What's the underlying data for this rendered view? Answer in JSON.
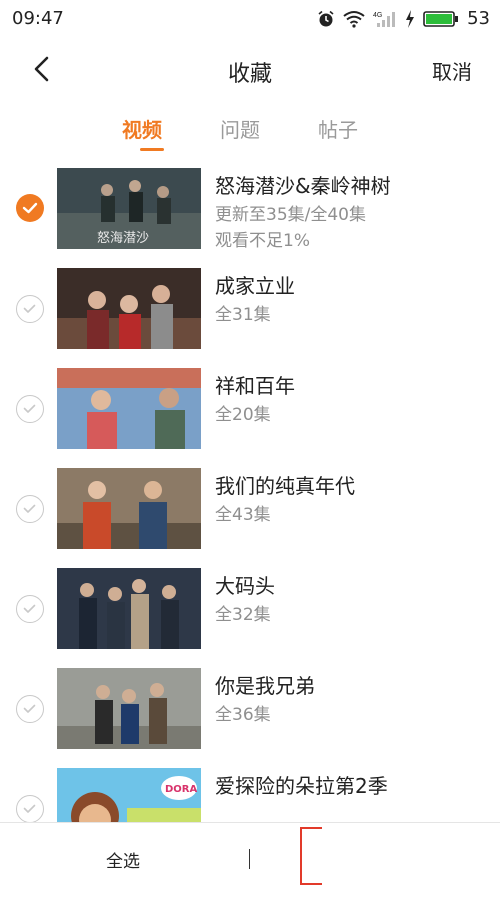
{
  "status": {
    "time": "09:47",
    "battery": "53",
    "network": "4G"
  },
  "header": {
    "title": "收藏",
    "cancel_label": "取消"
  },
  "tabs": [
    {
      "label": "视频",
      "active": true
    },
    {
      "label": "问题",
      "active": false
    },
    {
      "label": "帖子",
      "active": false
    }
  ],
  "items": [
    {
      "title": "怒海潜沙&秦岭神树",
      "subtitle": "更新至35集/全40集",
      "extra": "观看不足1%",
      "checked": true,
      "thumb_caption": "怒海潜沙"
    },
    {
      "title": "成家立业",
      "subtitle": "全31集",
      "checked": false
    },
    {
      "title": "祥和百年",
      "subtitle": "全20集",
      "checked": false
    },
    {
      "title": "我们的纯真年代",
      "subtitle": "全43集",
      "checked": false
    },
    {
      "title": "大码头",
      "subtitle": "全32集",
      "checked": false
    },
    {
      "title": "你是我兄弟",
      "subtitle": "全36集",
      "checked": false
    },
    {
      "title": "爱探险的朵拉第2季",
      "subtitle": "",
      "checked": false,
      "thumb_caption": "DORA"
    }
  ],
  "bottom": {
    "select_all_label": "全选"
  },
  "colors": {
    "accent": "#f07a22",
    "delete_border": "#e23a2a",
    "secondary_text": "#8f8f8f"
  }
}
